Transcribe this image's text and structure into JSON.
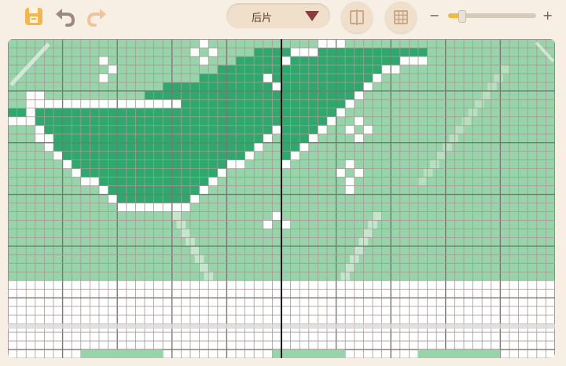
{
  "toolbar": {
    "save_icon": "save-icon",
    "undo_icon": "undo-icon",
    "redo_icon": "redo-icon",
    "view_dropdown": {
      "selected": "后片"
    },
    "split_icon": "split-view-icon",
    "grid_icon": "grid-icon",
    "zoom": {
      "minus": "−",
      "plus": "+",
      "level": 0.15
    }
  },
  "colors": {
    "accent": "#f2b64a",
    "pattern_dark": "#2fa86e",
    "pattern_light": "#98d4a9",
    "stitch_white": "#ffffff",
    "grid_line": "#a69a97",
    "grid_major": "#7d7475",
    "center_line": "#000000",
    "dropdown_arrow": "#8a3b3b"
  },
  "chart": {
    "cols": 60,
    "rows": 37,
    "centre_column": 30,
    "grid_major_every": 6,
    "green_rows": 28
  }
}
